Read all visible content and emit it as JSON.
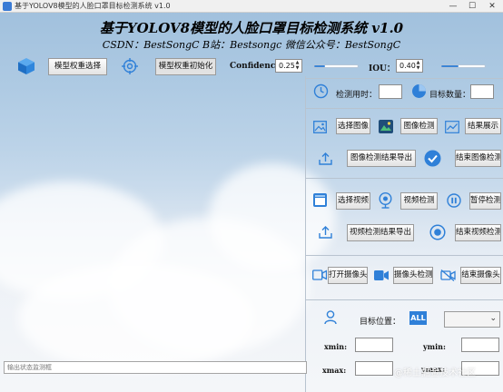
{
  "window": {
    "title": "基于YOLOV8模型的人脸口罩目标检测系统 v1.0",
    "minimize": "—",
    "maximize": "☐",
    "close": "✕"
  },
  "header": {
    "title": "基于YOLOV8模型的人脸口罩目标检测系统 v1.0",
    "subtitle": "CSDN：BestSongC   B站：Bestsongc   微信公众号：BestSongC"
  },
  "top_controls": {
    "model_select_label": "模型权重选择",
    "model_init_label": "模型权重初始化",
    "confidence_label": "Confidence:",
    "confidence_value": "0.25",
    "confidence_level": 0.25,
    "iou_label": "IOU：",
    "iou_value": "0.40",
    "iou_level": 0.4
  },
  "stats": {
    "time_label": "检测用时：",
    "time_value": "",
    "count_label": "目标数量：",
    "count_value": ""
  },
  "image_section": {
    "select_label": "选择图像",
    "detect_label": "图像检测",
    "show_label": "结果展示",
    "export_label": "图像检测结果导出",
    "end_label": "结束图像检测"
  },
  "video_section": {
    "select_label": "选择视频",
    "detect_label": "视频检测",
    "pause_label": "暂停检测",
    "export_label": "视频检测结果导出",
    "end_label": "结束视频检测"
  },
  "camera_section": {
    "open_label": "打开摄像头",
    "detect_label": "摄像头检测",
    "end_label": "结束摄像头"
  },
  "target_section": {
    "position_label": "目标位置：",
    "all_label": "ALL",
    "combo_value": "",
    "xmin_label": "xmin:",
    "ymin_label": "ymin:",
    "xmax_label": "xmax:",
    "ymax_label": "ymax:",
    "xmin_value": "",
    "ymin_value": "",
    "xmax_value": "",
    "ymax_value": ""
  },
  "status": {
    "placeholder": "输出状态监测框"
  },
  "watermark": "@稀土掘金技术社区",
  "colors": {
    "accent": "#2f80d8",
    "slider": "#3b85d6"
  },
  "icons": [
    "cube-icon",
    "target-icon",
    "clock-icon",
    "pie-chart-icon",
    "image-icon",
    "gallery-icon",
    "chart-icon",
    "upload-icon",
    "check-icon",
    "video-folder-icon",
    "webcam-icon",
    "pause-icon",
    "stop-icon",
    "camera-icon",
    "camera-off-icon",
    "person-icon"
  ]
}
